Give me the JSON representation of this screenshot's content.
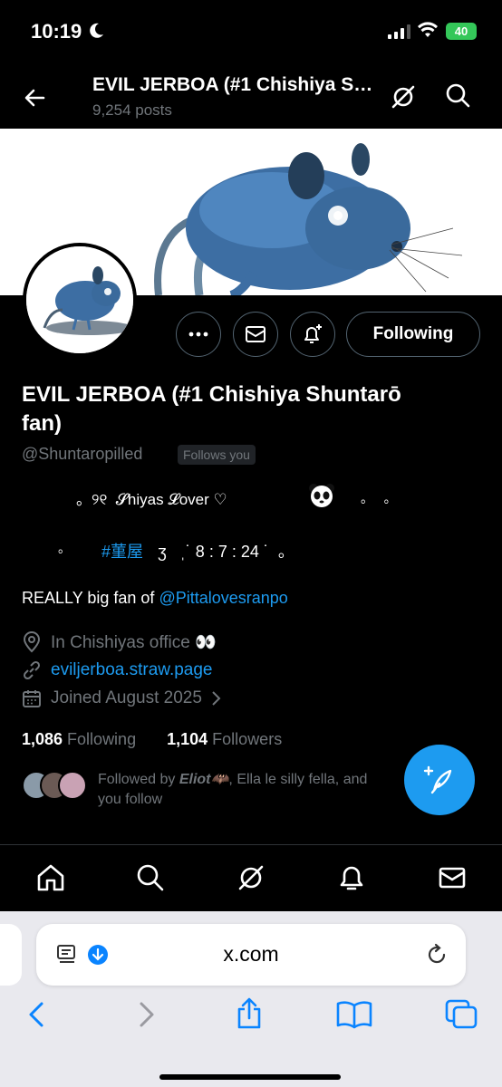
{
  "status": {
    "time": "10:19",
    "battery": "40"
  },
  "header": {
    "title": "EVIL JERBOA (#1 Chishiya Shuntarō fan)",
    "subtitle": "9,254 posts"
  },
  "actions": {
    "follow_label": "Following"
  },
  "profile": {
    "display_name": "EVIL JERBOA (#1 Chishiya Shuntarō fan)",
    "handle": "@Shuntaropilled",
    "follows_you": "Follows you",
    "bio_line1": "。୨୧  𝓢hiyas 𝓛over ♡",
    "bio_line1_dots": "。   。",
    "bio_line2_start": "。",
    "bio_hashtag": "#菫屋",
    "bio_line2_end": "ʒ   ˌ˙ 8 : 7 : 24 ˙  。",
    "bio_line3_prefix": "REALLY big fan of ",
    "bio_mention": "@Pittalovesranpo",
    "location": "In Chishiyas office 👀",
    "website": "eviljerboa.straw.page",
    "joined": "Joined August 2025"
  },
  "counts": {
    "following_num": "1,086",
    "following_label": " Following",
    "followers_num": "1,104",
    "followers_label": " Followers"
  },
  "followed_by": {
    "prefix": "Followed by ",
    "name": "Eliot🦇",
    "rest": ", Ella le silly fella, and",
    "line2": "you follow"
  },
  "browser": {
    "url": "x.com"
  },
  "colors": {
    "accent": "#1d9bf0",
    "background": "#000000",
    "muted": "#71767b"
  },
  "icons": [
    "back-arrow-icon",
    "grok-icon",
    "search-icon",
    "more-icon",
    "mail-icon",
    "notification-plus-icon",
    "location-icon",
    "link-icon",
    "calendar-icon",
    "chevron-right-icon",
    "compose-icon",
    "home-icon",
    "bell-icon",
    "reader-icon",
    "download-icon",
    "reload-icon",
    "share-icon",
    "bookmarks-icon",
    "tabs-icon"
  ]
}
